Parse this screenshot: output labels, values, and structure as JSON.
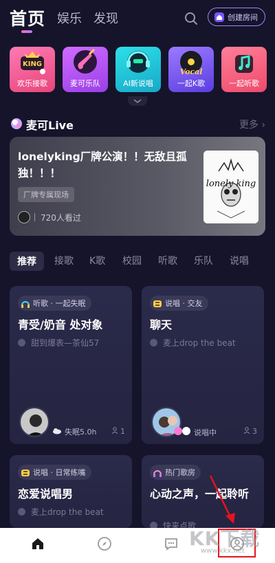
{
  "top_tabs": [
    {
      "label": "首页"
    },
    {
      "label": "娱乐"
    },
    {
      "label": "发现"
    }
  ],
  "create_room_label": "创建房间",
  "categories": [
    {
      "label": "欢乐接歌",
      "icon": "king-mic-icon",
      "color": "#ff5a9a"
    },
    {
      "label": "麦可乐队",
      "icon": "guitar-icon",
      "color": "#c24dff"
    },
    {
      "label": "AI新说唱",
      "icon": "robot-headphones-icon",
      "color": "#2cc9d8"
    },
    {
      "label": "一起K歌",
      "icon": "vocal-record-icon",
      "color": "#7f5cff"
    },
    {
      "label": "一起听歌",
      "icon": "music-note-icon",
      "color": "#ff5a7f"
    }
  ],
  "live": {
    "title": "麦可Live",
    "more": "更多",
    "card_title": "lonelyking厂牌公演！！无敌且孤独！！！",
    "tag": "厂牌专属现场",
    "viewers": "720人看过",
    "cover_text": "lonely king"
  },
  "content_tabs": [
    {
      "label": "推荐",
      "active": true
    },
    {
      "label": "接歌"
    },
    {
      "label": "K歌"
    },
    {
      "label": "校园"
    },
    {
      "label": "听歌"
    },
    {
      "label": "乐队"
    },
    {
      "label": "说唱"
    }
  ],
  "rooms": [
    {
      "tag": "听歌 · 一起失眠",
      "title": "青受/奶音 处对象",
      "sub": "甜到爆表—茶仙57",
      "meta": "失眠5.0h",
      "count": "1"
    },
    {
      "tag": "说唱 · 交友",
      "title": "聊天",
      "sub": "麦上drop the beat",
      "meta": "说唱中",
      "count": "3"
    },
    {
      "tag": "说唱 · 日常练嘴",
      "title": "恋爱说唱男",
      "sub": "麦上drop the beat"
    },
    {
      "tag": "热门歌房",
      "title": "心动之声，一起聆听",
      "sub": "快来点歌"
    }
  ],
  "bottom_nav": [
    {
      "icon": "home-icon",
      "active": true
    },
    {
      "icon": "compass-icon"
    },
    {
      "icon": "chat-icon"
    },
    {
      "icon": "profile-icon"
    }
  ],
  "watermark": {
    "text": "KK下载",
    "url": "www.kkx.net"
  },
  "colors": {
    "background": "#15142b",
    "card": "#2a2a4a",
    "accent": "#a785ff",
    "highlight": "#e4141e"
  }
}
